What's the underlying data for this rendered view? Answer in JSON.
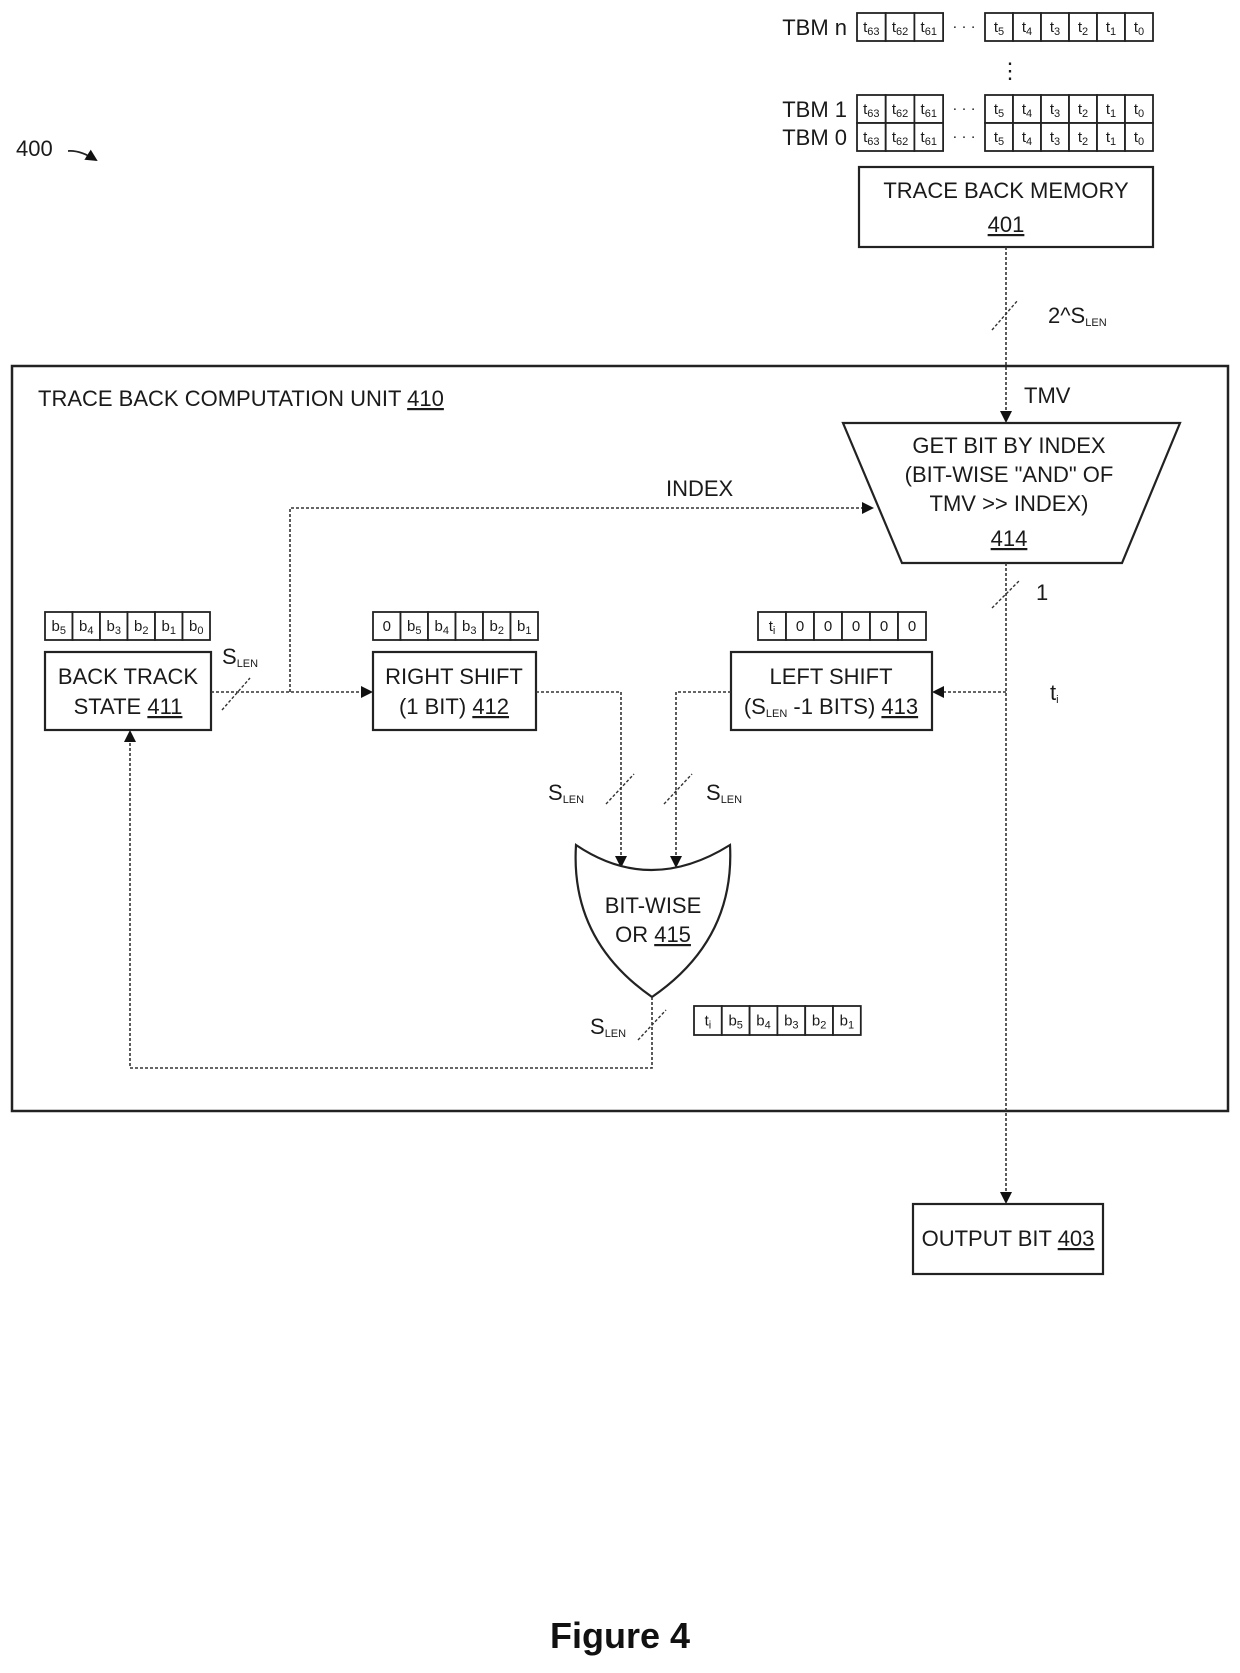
{
  "figure": {
    "ref_number": "400",
    "caption": "Figure 4"
  },
  "trace_back_memories": {
    "rows": [
      {
        "label": "TBM n",
        "high_cells": [
          "t63",
          "t62",
          "t61"
        ],
        "low_cells": [
          "t5",
          "t4",
          "t3",
          "t2",
          "t1",
          "t0"
        ]
      },
      {
        "label": "TBM 1",
        "high_cells": [
          "t63",
          "t62",
          "t61"
        ],
        "low_cells": [
          "t5",
          "t4",
          "t3",
          "t2",
          "t1",
          "t0"
        ]
      },
      {
        "label": "TBM 0",
        "high_cells": [
          "t63",
          "t62",
          "t61"
        ],
        "low_cells": [
          "t5",
          "t4",
          "t3",
          "t2",
          "t1",
          "t0"
        ]
      }
    ],
    "ellipsis_h": "· · ·",
    "ellipsis_v": "⋮"
  },
  "blocks": {
    "trace_back_memory": {
      "title": "TRACE BACK MEMORY",
      "ref": "401"
    },
    "computation_unit": {
      "title": "TRACE BACK COMPUTATION UNIT",
      "ref": "410"
    },
    "get_bit": {
      "line1": "GET BIT BY INDEX",
      "line2": "(BIT-WISE \"AND\" OF",
      "line3": "TMV >> INDEX)",
      "ref": "414"
    },
    "back_track_state": {
      "line1": "BACK TRACK",
      "line2": "STATE",
      "ref": "411"
    },
    "right_shift": {
      "line1": "RIGHT SHIFT",
      "line2": "(1 BIT)",
      "ref": "412"
    },
    "left_shift": {
      "line1": "LEFT SHIFT",
      "line2_pre": "(S",
      "line2_sub": "LEN",
      "line2_post": " -1 BITS)",
      "ref": "413"
    },
    "bitwise_or": {
      "line1": "BIT-WISE",
      "line2": "OR",
      "ref": "415"
    },
    "output_bit": {
      "title": "OUTPUT BIT",
      "ref": "403"
    }
  },
  "signals": {
    "tmv_bus_width_pre": "2^S",
    "tmv_bus_width_sub": "LEN",
    "tmv": "TMV",
    "index": "INDEX",
    "get_bit_width": "1",
    "ti_main": "t",
    "ti_sub": "i",
    "slen_main": "S",
    "slen_sub": "LEN"
  },
  "vectors": {
    "back_track_state": [
      "b5",
      "b4",
      "b3",
      "b2",
      "b1",
      "b0"
    ],
    "right_shift": [
      "0",
      "b5",
      "b4",
      "b3",
      "b2",
      "b1"
    ],
    "left_shift": [
      "ti",
      "0",
      "0",
      "0",
      "0",
      "0"
    ],
    "or_result": [
      "ti",
      "b5",
      "b4",
      "b3",
      "b2",
      "b1"
    ]
  }
}
